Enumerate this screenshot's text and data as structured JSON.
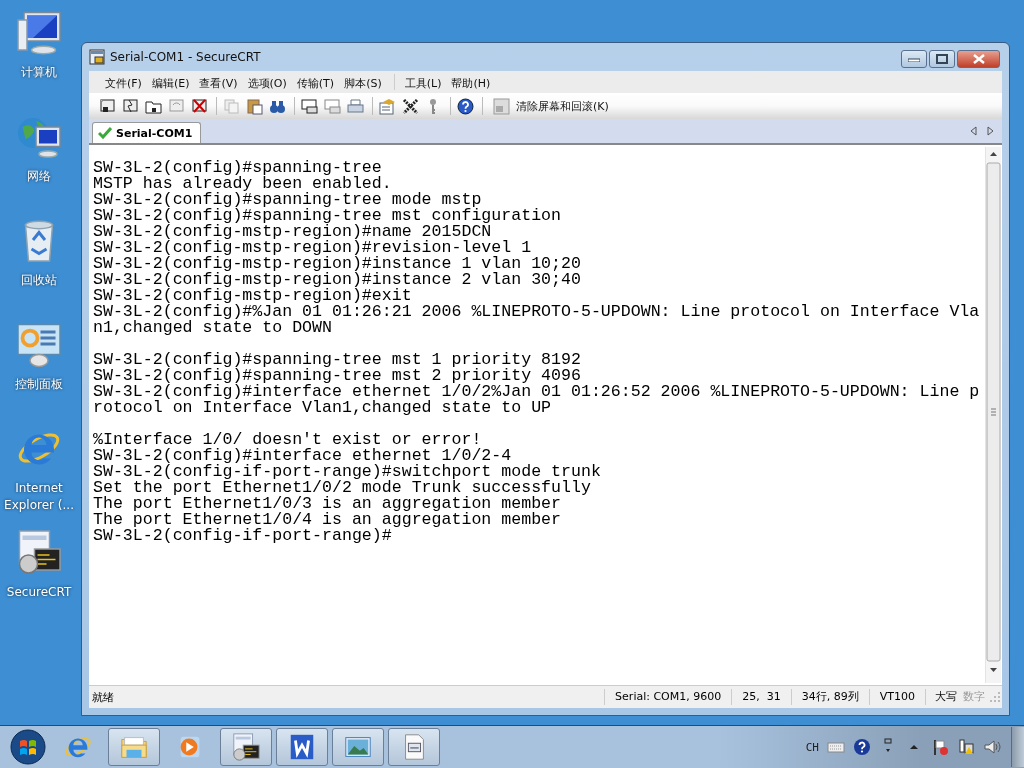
{
  "desktop_icons": [
    {
      "label": "计算机",
      "kind": "computer"
    },
    {
      "label": "网络",
      "kind": "network"
    },
    {
      "label": "回收站",
      "kind": "recycle"
    },
    {
      "label": "控制面板",
      "kind": "control"
    },
    {
      "label": "Internet Explorer (...",
      "kind": "browser"
    },
    {
      "label": "SecureCRT",
      "kind": "terminal"
    }
  ],
  "window": {
    "title": "Serial-COM1 - SecureCRT"
  },
  "menu": [
    "文件(F)",
    "编辑(E)",
    "查看(V)",
    "选项(O)",
    "传输(T)",
    "脚本(S)",
    "工具(L)",
    "帮助(H)"
  ],
  "toolbar": {
    "clear_button": "清除屏幕和回滚(K)"
  },
  "tabs": [
    {
      "label": "Serial-COM1",
      "selected": true,
      "connected": true
    }
  ],
  "terminal": {
    "blocks": [
      {
        "lines": [
          "SW-3L-2(config)#spanning-tree",
          "MSTP has already been enabled.",
          "SW-3L-2(config)#spanning-tree mode mstp",
          "SW-3L-2(config)#spanning-tree mst configuration",
          "SW-3L-2(config-mstp-region)#name 2015DCN",
          "SW-3L-2(config-mstp-region)#revision-level 1",
          "SW-3L-2(config-mstp-region)#instance 1 vlan 10;20",
          "SW-3L-2(config-mstp-region)#instance 2 vlan 30;40",
          "SW-3L-2(config-mstp-region)#exit",
          "SW-3L-2(config)#%Jan 01 01:26:21 2006 %LINEPROTO-5-UPDOWN: Line protocol on Interface Vla",
          "n1,changed state to DOWN"
        ]
      },
      {
        "lines": [
          "SW-3L-2(config)#spanning-tree mst 1 priority 8192",
          "SW-3L-2(config)#spanning-tree mst 2 priority 4096",
          "SW-3L-2(config)#interface ethernet 1/0/2%Jan 01 01:26:52 2006 %LINEPROTO-5-UPDOWN: Line p",
          "rotocol on Interface Vlan1,changed state to UP"
        ]
      },
      {
        "lines": [
          "%Interface 1/0/ doesn't exist or error!",
          "SW-3L-2(config)#interface ethernet 1/0/2-4",
          "SW-3L-2(config-if-port-range)#switchport mode trunk",
          "Set the port Ethernet1/0/2 mode Trunk successfully",
          "The port Ethernet1/0/3 is an aggregation member",
          "The port Ethernet1/0/4 is an aggregation member",
          "SW-3L-2(config-if-port-range)#"
        ]
      }
    ]
  },
  "status_bar": {
    "message": "就绪",
    "connection": "Serial: COM1, 9600",
    "cursor": "25,  31",
    "size": "34行, 89列",
    "emulation": "VT100",
    "indicators": [
      {
        "label": "大写",
        "on": true
      },
      {
        "label": "数字",
        "on": false
      }
    ]
  },
  "taskbar": {
    "items": [
      {
        "kind": "browser",
        "running": false
      },
      {
        "kind": "folder",
        "running": true
      },
      {
        "kind": "media",
        "running": false
      },
      {
        "kind": "terminal",
        "running": true
      },
      {
        "kind": "writer",
        "running": true
      },
      {
        "kind": "picture",
        "running": true
      },
      {
        "kind": "document",
        "running": true
      }
    ],
    "language": "CH"
  }
}
